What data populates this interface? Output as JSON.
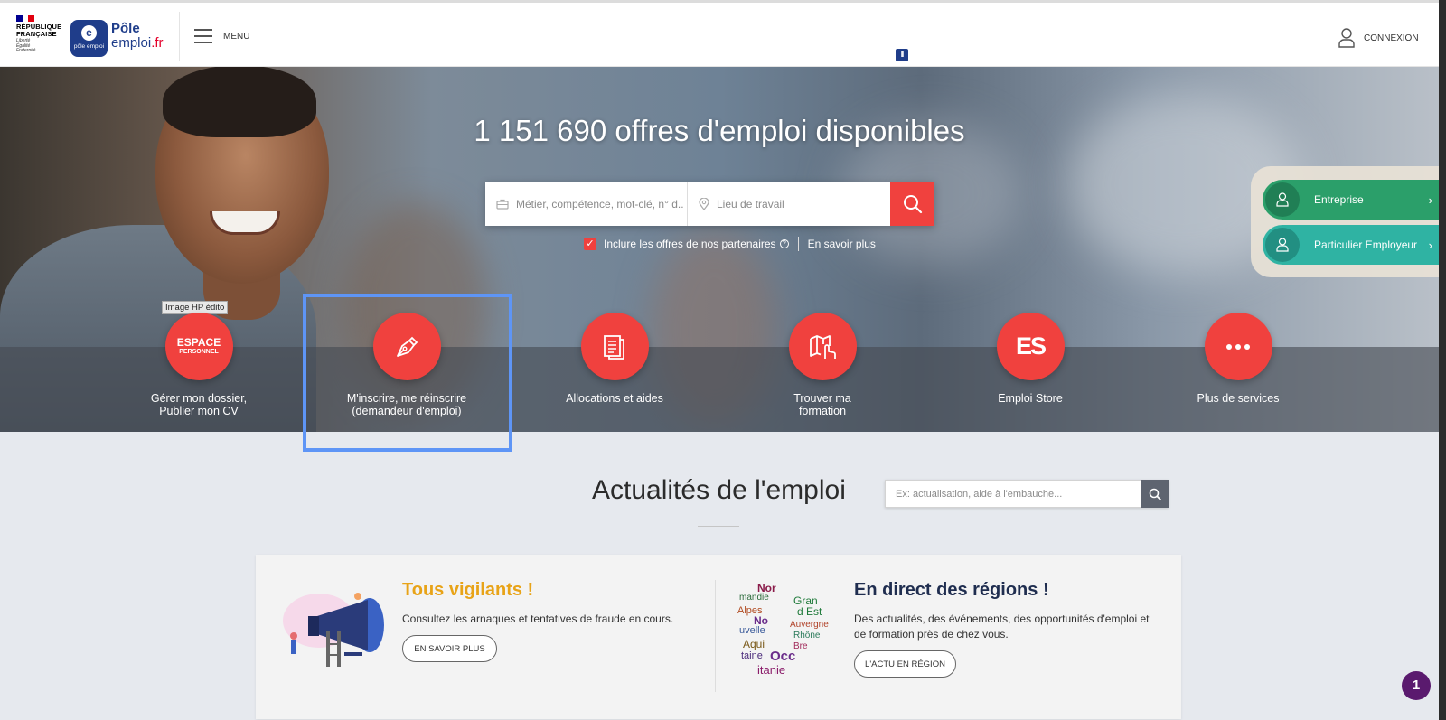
{
  "header": {
    "republic_line1": "RÉPUBLIQUE",
    "republic_line2": "FRANÇAISE",
    "motto1": "Liberté",
    "motto2": "Égalité",
    "motto3": "Fraternité",
    "logo_small": "pôle emploi",
    "logo_line1": "Pôle",
    "logo_line2": "emploi",
    "logo_tld": ".fr",
    "menu_label": "MENU",
    "pause_glyph": "II",
    "login_label": "CONNEXION"
  },
  "hero": {
    "headline": "1 151 690 offres d'emploi disponibles",
    "search": {
      "job_placeholder": "Métier, compétence, mot-clé, n° d...",
      "location_placeholder": "Lieu de travail"
    },
    "partners_checkbox": {
      "checked": true,
      "label": "Inclure les offres de nos partenaires",
      "help": "?",
      "more_link": "En savoir plus"
    },
    "image_tag": "Image HP édito",
    "side_buttons": [
      {
        "label": "Entreprise",
        "color": "#2b9f6a"
      },
      {
        "label": "Particulier Employeur",
        "color": "#2fb3a3"
      }
    ],
    "tiles": [
      {
        "label": "Gérer mon dossier,\nPublier mon CV",
        "icon_text": "ESPACE",
        "icon_sub": "PERSONNEL"
      },
      {
        "label": "M'inscrire, me réinscrire\n(demandeur d'emploi)",
        "icon": "pen-nib-icon"
      },
      {
        "label": "Allocations et aides",
        "icon": "document-icon"
      },
      {
        "label": "Trouver ma\nformation",
        "icon": "map-hand-icon"
      },
      {
        "label": "Emploi Store",
        "icon_text": "ES"
      },
      {
        "label": "Plus de services",
        "icon": "more-dots-icon"
      }
    ]
  },
  "news": {
    "title": "Actualités de l'emploi",
    "search_placeholder": "Ex: actualisation, aide à l'embauche...",
    "cards": [
      {
        "title": "Tous vigilants !",
        "text": "Consultez les arnaques et tentatives de fraude en cours.",
        "button": "EN SAVOIR PLUS",
        "title_color": "#e8a317"
      },
      {
        "title": "En direct des régions !",
        "text": "Des actualités, des événements, des opportunités d'emploi et de formation près de chez vous.",
        "button": "L'ACTU EN RÉGION",
        "title_color": "#1f2d4f",
        "map_words": [
          "Gran",
          "d Est",
          "No",
          "uvelle",
          "Aqui",
          "taine",
          "Occ",
          "itanie",
          "Auvergne",
          "Rhône",
          "Alpes",
          "Bre",
          "Nor",
          "mandie"
        ]
      }
    ]
  },
  "chat_badge": "1",
  "colors": {
    "brand_blue": "#1f3d8a",
    "accent_red": "#f0413e",
    "highlight_blue": "#5e95f6"
  }
}
